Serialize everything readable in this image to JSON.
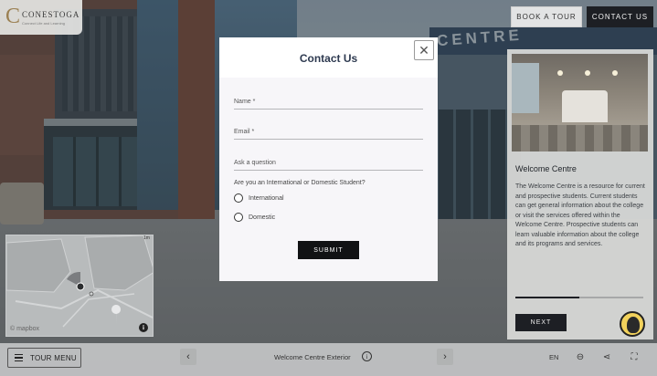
{
  "brand": {
    "logo_mark": "C",
    "name": "CONESTOGA",
    "tagline": "Connect Life and Learning"
  },
  "header": {
    "book_tour_label": "BOOK A TOUR",
    "contact_us_label": "CONTACT US"
  },
  "scene_sign": "CENTRE",
  "modal": {
    "title": "Contact Us",
    "close_label": "✕",
    "fields": {
      "name_label": "Name *",
      "email_label": "Email *",
      "ask_label": "Ask a question"
    },
    "question": "Are you an International or Domestic Student?",
    "options": [
      "International",
      "Domestic"
    ],
    "submit_label": "SUBMIT"
  },
  "info_panel": {
    "title": "Welcome Centre",
    "description": "The Welcome Centre is a resource for current and prospective students. Current students can get general information about the college or visit the services offered within the Welcome Centre. Prospective students can learn valuable information about the college and its programs and services.",
    "progress": 0.5,
    "next_label": "NEXT"
  },
  "map": {
    "scale_label": "1m",
    "attribution": "© mapbox",
    "info_label": "i"
  },
  "bottom_bar": {
    "tour_menu_label": "TOUR MENU",
    "prev_icon": "‹",
    "next_icon": "›",
    "scene_name": "Welcome Centre Exterior",
    "scene_info_label": "i",
    "language": "EN",
    "link_icon": "⊖",
    "share_icon": "⋖",
    "fullscreen_icon": "⛶"
  },
  "colors": {
    "accent_dark": "#1d1f24",
    "title_navy": "#2e3a50",
    "logo_gold": "#9b8052"
  }
}
